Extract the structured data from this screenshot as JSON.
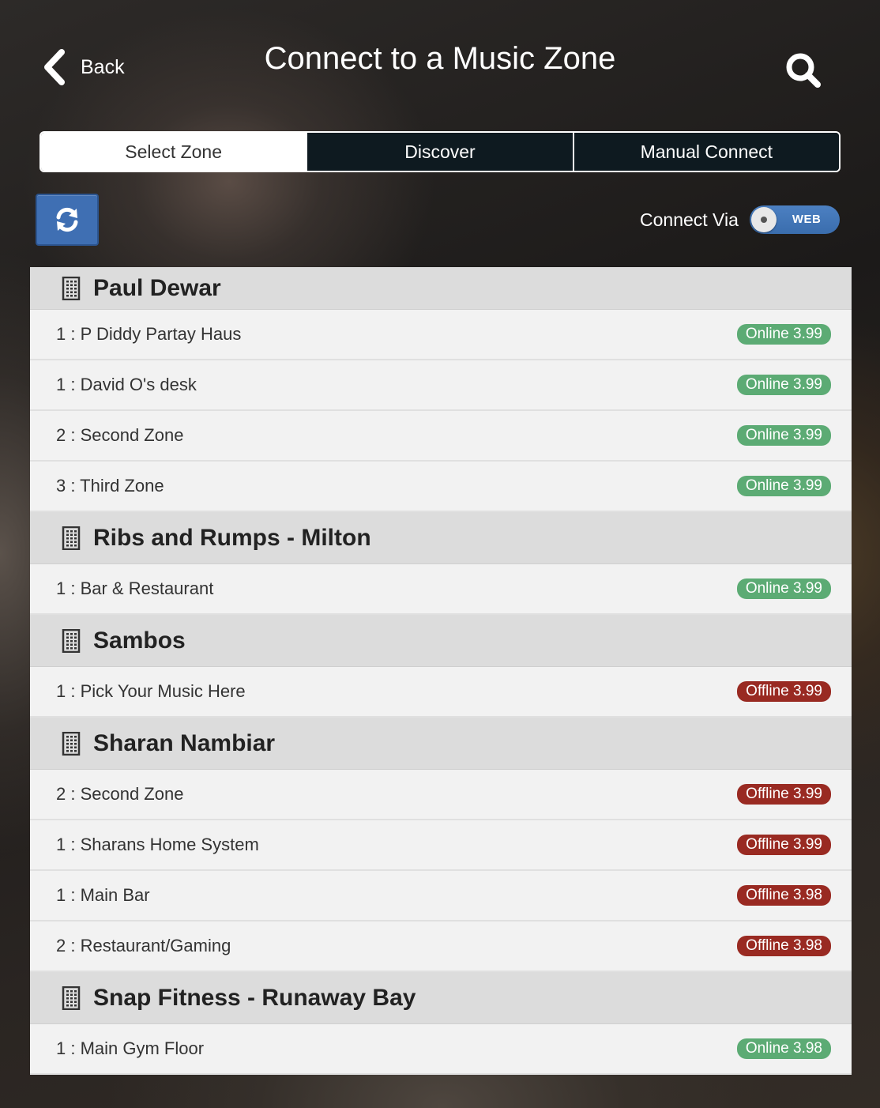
{
  "header": {
    "back_label": "Back",
    "title": "Connect to a Music Zone"
  },
  "tabs": [
    {
      "label": "Select Zone",
      "active": true
    },
    {
      "label": "Discover",
      "active": false
    },
    {
      "label": "Manual Connect",
      "active": false
    }
  ],
  "toolbar": {
    "refresh_icon": "refresh-icon",
    "connect_via_label": "Connect Via",
    "connect_via_value": "WEB"
  },
  "colors": {
    "online": "#5cab74",
    "offline": "#992a22",
    "accent": "#3f6fb3"
  },
  "groups": [
    {
      "name": "Paul Dewar",
      "zones": [
        {
          "name": "1 : P Diddy Partay Haus",
          "status": "Online 3.99",
          "state": "online"
        },
        {
          "name": "1 : David O's desk",
          "status": "Online 3.99",
          "state": "online"
        },
        {
          "name": "2 : Second Zone",
          "status": "Online 3.99",
          "state": "online"
        },
        {
          "name": "3 : Third Zone",
          "status": "Online 3.99",
          "state": "online"
        }
      ]
    },
    {
      "name": "Ribs and Rumps - Milton",
      "zones": [
        {
          "name": "1 : Bar & Restaurant",
          "status": "Online 3.99",
          "state": "online"
        }
      ]
    },
    {
      "name": "Sambos",
      "zones": [
        {
          "name": "1 : Pick Your Music Here",
          "status": "Offline 3.99",
          "state": "offline"
        }
      ]
    },
    {
      "name": "Sharan Nambiar",
      "zones": [
        {
          "name": "2 : Second Zone",
          "status": "Offline 3.99",
          "state": "offline"
        },
        {
          "name": "1 : Sharans Home System",
          "status": "Offline 3.99",
          "state": "offline"
        },
        {
          "name": "1 : Main Bar",
          "status": "Offline 3.98",
          "state": "offline"
        },
        {
          "name": "2 : Restaurant/Gaming",
          "status": "Offline 3.98",
          "state": "offline"
        }
      ]
    },
    {
      "name": "Snap Fitness - Runaway Bay",
      "zones": [
        {
          "name": "1 : Main Gym Floor",
          "status": "Online 3.98",
          "state": "online"
        }
      ]
    }
  ]
}
